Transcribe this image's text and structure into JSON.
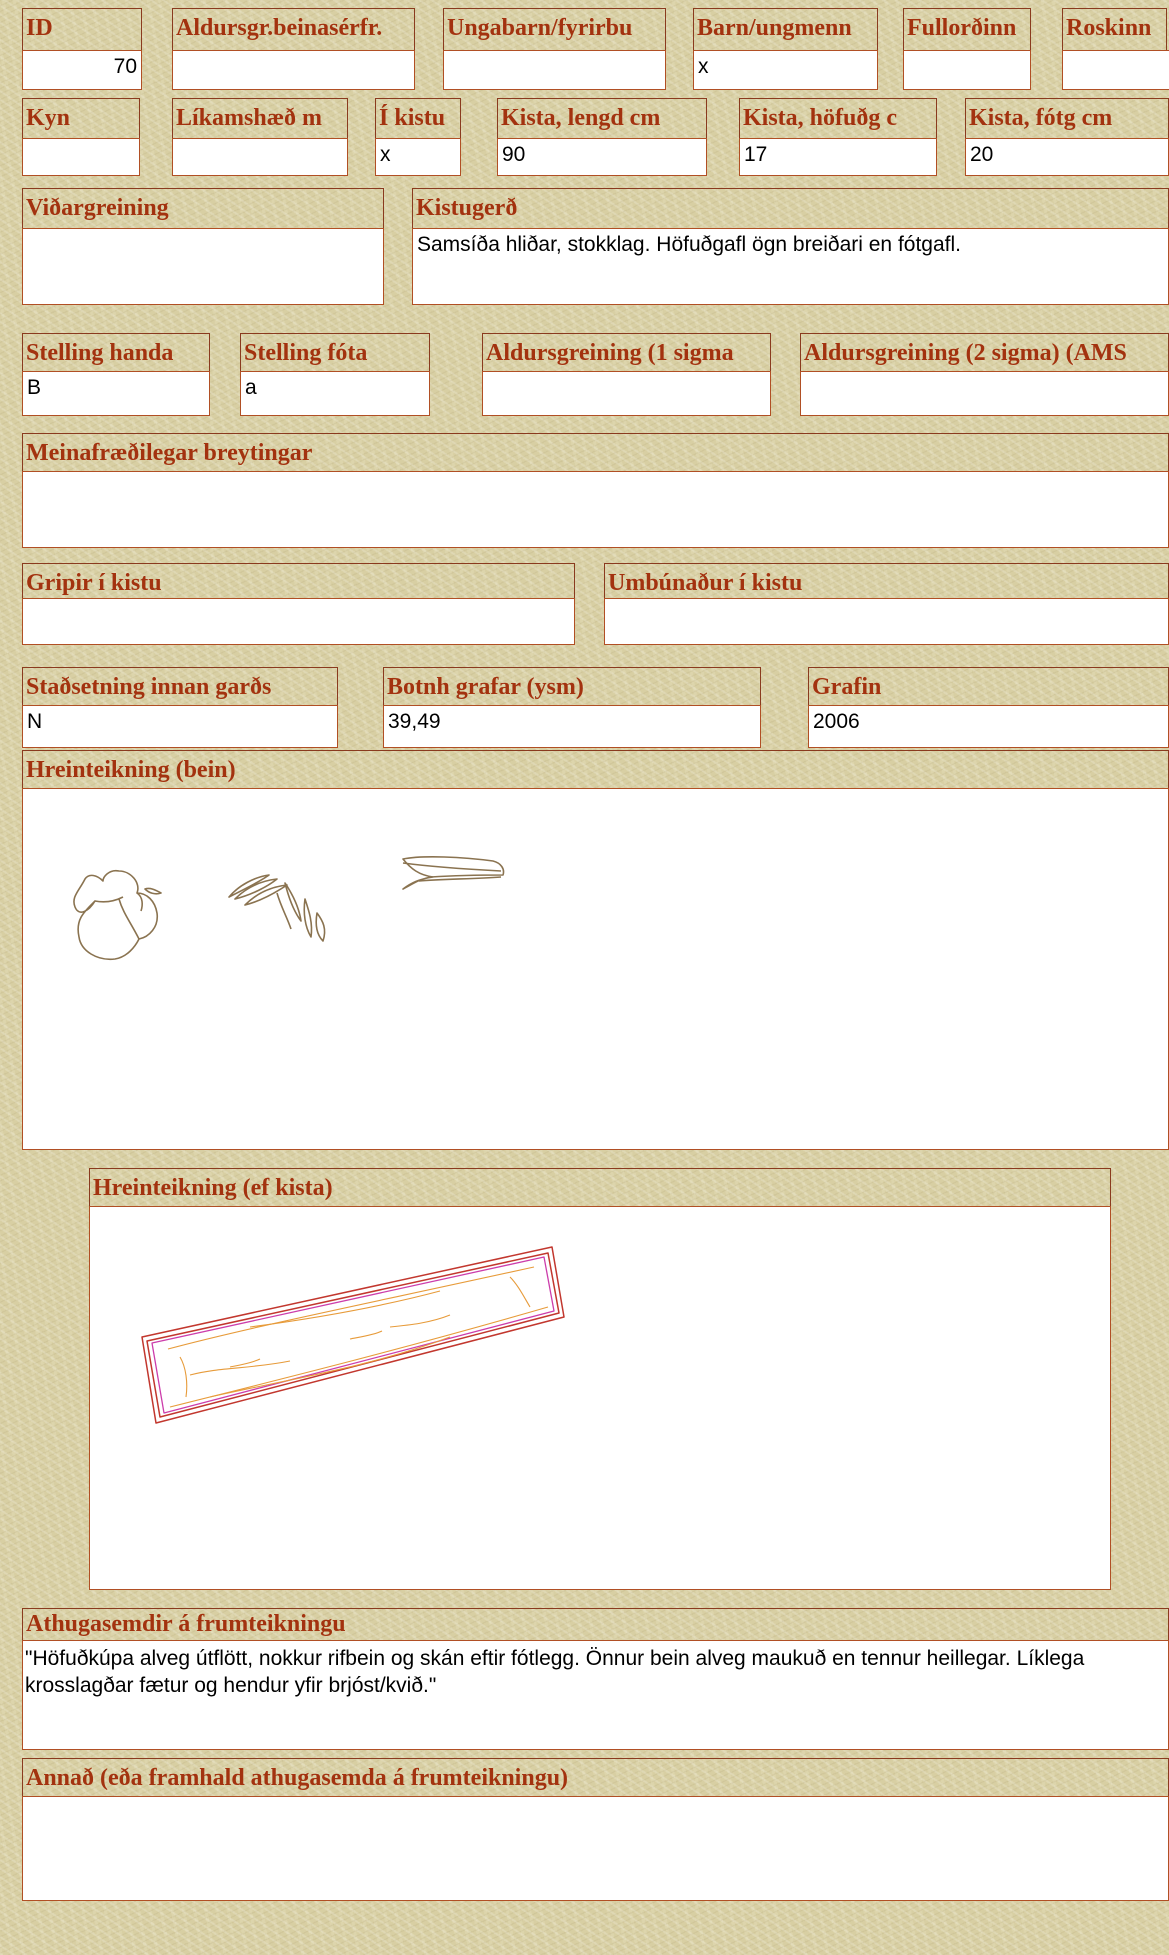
{
  "row1": {
    "id": {
      "label": "ID",
      "value": "70"
    },
    "aldursgr": {
      "label": "Aldursgr.beinasérfr.",
      "value": ""
    },
    "ungabarn": {
      "label": "Ungabarn/fyrirbu",
      "value": ""
    },
    "barn": {
      "label": "Barn/ungmenn",
      "value": "x"
    },
    "fullordinn": {
      "label": "Fullorðinn",
      "value": ""
    },
    "roskinn": {
      "label": "Roskinn",
      "value": ""
    }
  },
  "row2": {
    "kyn": {
      "label": "Kyn",
      "value": ""
    },
    "likamshaed": {
      "label": "Líkamshæð m",
      "value": ""
    },
    "i_kistu": {
      "label": "Í kistu",
      "value": "x"
    },
    "kista_lengd": {
      "label": "Kista, lengd cm",
      "value": "90"
    },
    "kista_hofud": {
      "label": "Kista, höfuðg c",
      "value": "17"
    },
    "kista_fotg": {
      "label": "Kista, fótg cm",
      "value": "20"
    }
  },
  "row3": {
    "vidargreining": {
      "label": "Viðargreining",
      "value": ""
    },
    "kistugerd": {
      "label": "Kistugerð",
      "value": "Samsíða hliðar, stokklag. Höfuðgafl ögn breiðari en fótgafl."
    }
  },
  "row4": {
    "stelling_handa": {
      "label": "Stelling handa",
      "value": "B"
    },
    "stelling_fota": {
      "label": "Stelling fóta",
      "value": "a"
    },
    "aldurs1": {
      "label": "Aldursgreining (1 sigma",
      "value": ""
    },
    "aldurs2": {
      "label": "Aldursgreining (2 sigma) (AMS",
      "value": ""
    }
  },
  "meina": {
    "label": "Meinafræðilegar breytingar",
    "value": ""
  },
  "row6": {
    "gripir": {
      "label": "Gripir í kistu",
      "value": ""
    },
    "umbunadur": {
      "label": "Umbúnaður í kistu",
      "value": ""
    }
  },
  "row7": {
    "stadsetning": {
      "label": "Staðsetning innan garðs",
      "value": "N"
    },
    "botnh": {
      "label": "Botnh grafar (ysm)",
      "value": "39,49"
    },
    "grafin": {
      "label": "Grafin",
      "value": "2006"
    }
  },
  "hrein_bein": {
    "label": "Hreinteikning (bein)"
  },
  "hrein_kista": {
    "label": "Hreinteikning (ef kista)"
  },
  "athugasemdir": {
    "label": "Athugasemdir á frumteikningu",
    "value": "\"Höfuðkúpa alveg útflött, nokkur rifbein og skán eftir fótlegg. Önnur bein alveg maukuð en tennur heillegar. Líklega krosslagðar fætur og hendur yfir brjóst/kvið.\""
  },
  "annad": {
    "label": "Annað (eða framhald athugasemda á frumteikningu)",
    "value": ""
  }
}
